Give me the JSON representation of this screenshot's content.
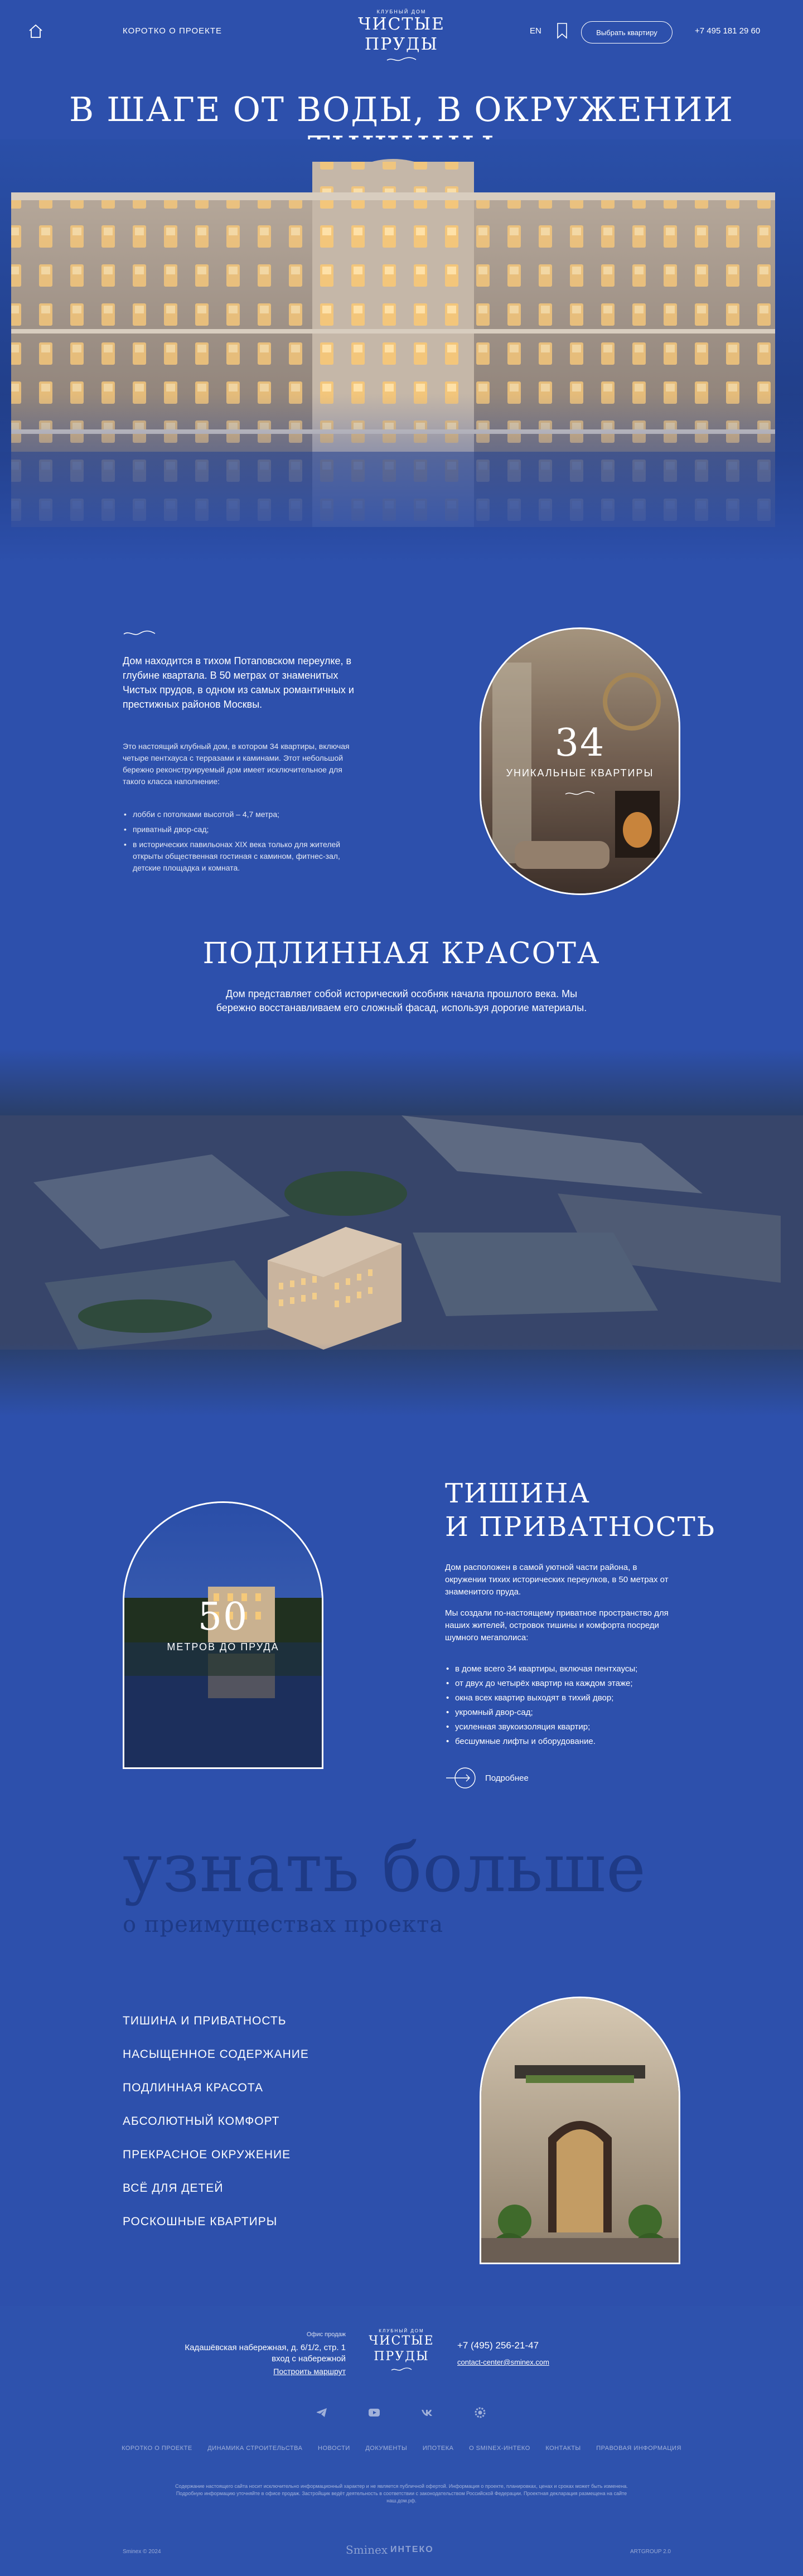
{
  "header": {
    "about_link": "КОРОТКО О ПРОЕКТЕ",
    "logo_small": "КЛУБНЫЙ ДОМ",
    "logo_name": "ЧИСТЫЕ ПРУДЫ",
    "lang": "EN",
    "choose_button": "Выбрать квартиру",
    "phone": "+7 495 181 29 60",
    "icons": [
      "home-icon",
      "bookmark-icon"
    ]
  },
  "hero": {
    "title": "В ШАГЕ ОТ ВОДЫ, В ОКРУЖЕНИИ ТИШИНЫ"
  },
  "intro": {
    "lead": "Дом находится в тихом Потаповском переулке, в глубине квартала. В 50 метрах от знаменитых Чистых прудов, в одном из самых романтичных и престижных районов Москвы.",
    "paragraph": "Это настоящий клубный дом, в котором 34 квартиры, включая четыре пентхауса с терразами и каминами. Этот небольшой бережно реконструируемый дом имеет исключительное для такого класса наполнение:",
    "list": [
      "лобби с потолками высотой – 4,7 метра;",
      "приватный двор-сад;",
      "в исторических павильонах XIX века только для жителей открыты общественная гостиная с камином, фитнес-зал, детские площадка и комната."
    ],
    "stat_number": "34",
    "stat_caption": "УНИКАЛЬНЫЕ КВАРТИРЫ"
  },
  "beauty": {
    "title": "ПОДЛИННАЯ КРАСОТА",
    "text": "Дом представляет собой исторический особняк начала прошлого века. Мы бережно восстанавливаем его сложный фасад, используя дорогие материалы."
  },
  "quiet": {
    "title_line1": "ТИШИНА",
    "title_line2": "И ПРИВАТНОСТЬ",
    "p1": "Дом расположен в самой уютной части района, в окружении тихих исторических переулков, в 50 метрах от знаменитого пруда.",
    "p2": "Мы создали по-настоящему приватное пространство для наших жителей, островок тишины и комфорта посреди шумного мегаполиса:",
    "list": [
      "в доме всего 34 квартиры, включая пентхаусы;",
      "от двух до четырёх квартир на каждом этаже;",
      "окна всех квартир выходят в тихий двор;",
      "укромный двор-сад;",
      "усиленная звукоизоляция квартир;",
      "бесшумные лифты и оборудование."
    ],
    "stat_number": "50",
    "stat_caption": "МЕТРОВ ДО ПРУДА",
    "more": "Подробнее"
  },
  "learn": {
    "big": "узнать больше",
    "sub": "о преимуществах проекта",
    "items": [
      "ТИШИНА И ПРИВАТНОСТЬ",
      "НАСЫЩЕННОЕ СОДЕРЖАНИЕ",
      "ПОДЛИННАЯ КРАСОТА",
      "АБСОЛЮТНЫЙ КОМФОРТ",
      "ПРЕКРАСНОЕ ОКРУЖЕНИЕ",
      "ВСЁ ДЛЯ ДЕТЕЙ",
      "РОСКОШНЫЕ КВАРТИРЫ"
    ]
  },
  "footer": {
    "office_label": "Офис продаж",
    "address_line1": "Кадашёвская набережная, д. 6/1/2, стр. 1",
    "address_line2": "вход с набережной",
    "route": "Построить маршрут",
    "logo_small": "КЛУБНЫЙ ДОМ",
    "logo_line1": "ЧИСТЫЕ",
    "logo_line2": "ПРУДЫ",
    "phone": "+7 (495) 256-21-47",
    "email": "contact-center@sminex.com",
    "social_icons": [
      "telegram-icon",
      "youtube-icon",
      "vk-icon",
      "settings-icon"
    ],
    "nav": [
      "КОРОТКО О ПРОЕКТЕ",
      "ДИНАМИКА СТРОИТЕЛЬСТВА",
      "НОВОСТИ",
      "ДОКУМЕНТЫ",
      "ИПОТЕКА",
      "О SMINEX-ИНТЕКО",
      "КОНТАКТЫ",
      "ПРАВОВАЯ ИНФОРМАЦИЯ"
    ],
    "legal": "Содержание настоящего сайта носит исключительно информационный характер и не является публичной офертой. Информация о проекте, планировках, ценах и сроках может быть изменена. Подробную информацию уточняйте в офисе продаж. Застройщик ведёт деятельность в соответствии с законодательством Российской Федерации. Проектная декларация размещена на сайте наш.дом.рф.",
    "copyright": "Sminex © 2024",
    "brand1": "Sminex",
    "brand2": "ИНТЕКО",
    "developer": "ARTGROUP 2.0"
  },
  "colors": {
    "background": "#2d50ac",
    "text": "#ffffff",
    "watermark": "#1e3a86"
  }
}
